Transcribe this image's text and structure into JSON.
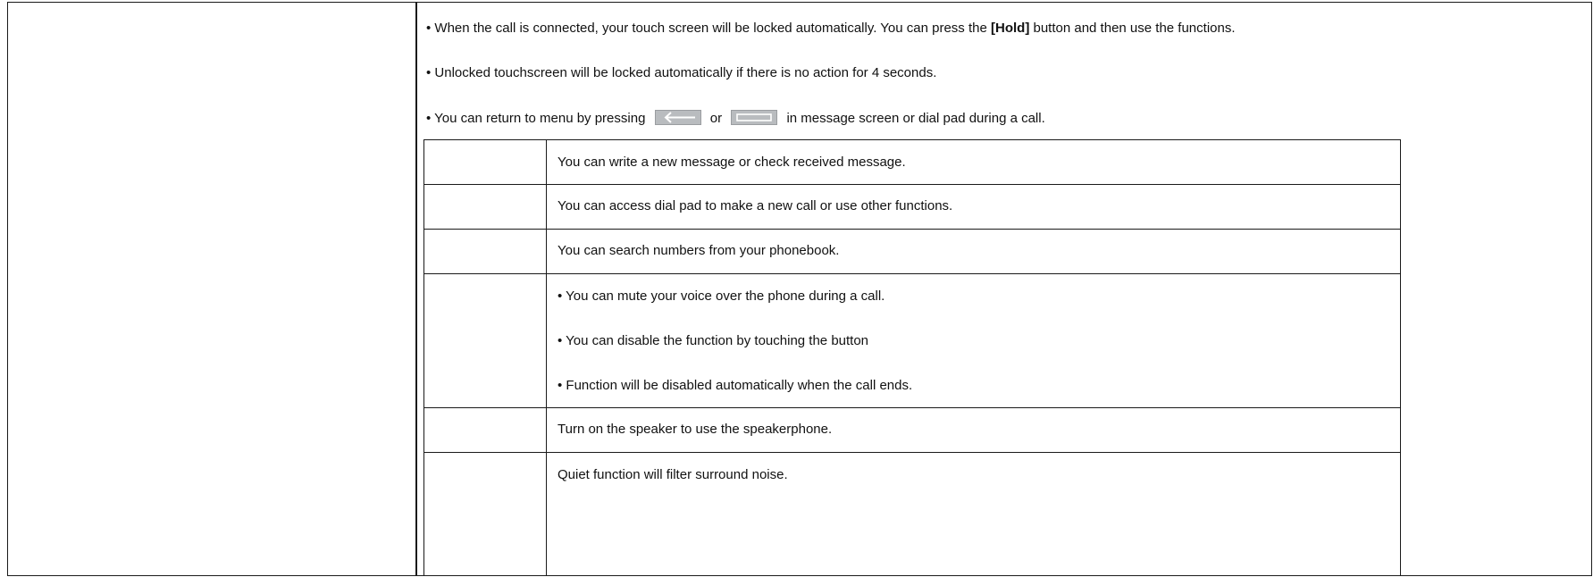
{
  "notes": {
    "note1": {
      "prefix": "• When the call is connected, your touch screen will be locked automatically. You can press the ",
      "bold": "[Hold]",
      "suffix": " button and then use the functions."
    },
    "note2": "• Unlocked touchscreen will be locked automatically if there is no action for 4 seconds.",
    "note3": {
      "prefix": "• You can return to menu by pressing",
      "back_icon": "back-arrow-button-icon",
      "connector": "or",
      "menu_icon": "menu-bar-button-icon",
      "suffix": "in message screen or dial pad during a call."
    }
  },
  "functions": [
    {
      "text": "You can write a new message or check received message."
    },
    {
      "text": "You can access dial pad to make a new call or use other functions."
    },
    {
      "text": "You can search numbers from your phonebook."
    },
    {
      "lines": [
        "• You can mute your voice over the phone during a call.",
        "• You can disable the function by touching the button",
        "• Function will be disabled automatically when the call ends."
      ]
    },
    {
      "text": "Turn on the speaker to use the speakerphone."
    },
    {
      "text": "Quiet function will filter surround noise."
    }
  ],
  "colors": {
    "border": "#1a1a1a",
    "button_graphic_fill": "#b9bcbf",
    "button_graphic_glyph": "#ffffff"
  }
}
